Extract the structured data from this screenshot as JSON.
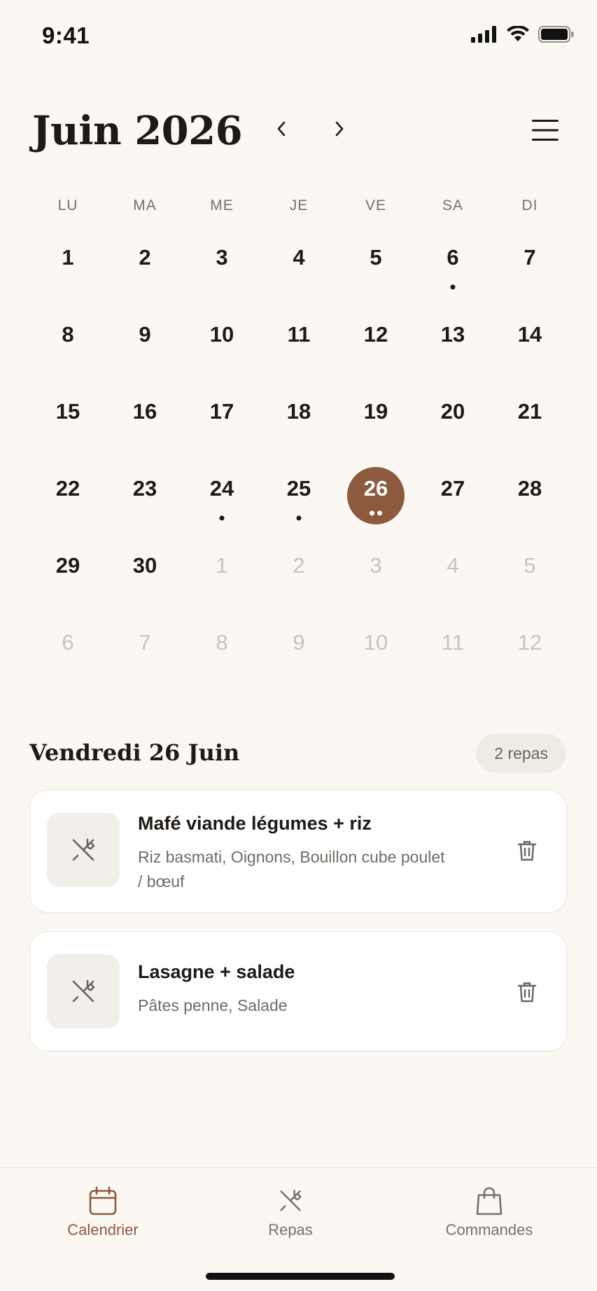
{
  "status": {
    "time": "9:41"
  },
  "header": {
    "month_title": "Juin 2026"
  },
  "weekdays": [
    "LU",
    "MA",
    "ME",
    "JE",
    "VE",
    "SA",
    "DI"
  ],
  "calendar": {
    "days": [
      {
        "n": "1",
        "muted": false,
        "dots": 0
      },
      {
        "n": "2",
        "muted": false,
        "dots": 0
      },
      {
        "n": "3",
        "muted": false,
        "dots": 0
      },
      {
        "n": "4",
        "muted": false,
        "dots": 0
      },
      {
        "n": "5",
        "muted": false,
        "dots": 0
      },
      {
        "n": "6",
        "muted": false,
        "dots": 1
      },
      {
        "n": "7",
        "muted": false,
        "dots": 0
      },
      {
        "n": "8",
        "muted": false,
        "dots": 0
      },
      {
        "n": "9",
        "muted": false,
        "dots": 0
      },
      {
        "n": "10",
        "muted": false,
        "dots": 0
      },
      {
        "n": "11",
        "muted": false,
        "dots": 0
      },
      {
        "n": "12",
        "muted": false,
        "dots": 0
      },
      {
        "n": "13",
        "muted": false,
        "dots": 0
      },
      {
        "n": "14",
        "muted": false,
        "dots": 0
      },
      {
        "n": "15",
        "muted": false,
        "dots": 0
      },
      {
        "n": "16",
        "muted": false,
        "dots": 0
      },
      {
        "n": "17",
        "muted": false,
        "dots": 0
      },
      {
        "n": "18",
        "muted": false,
        "dots": 0
      },
      {
        "n": "19",
        "muted": false,
        "dots": 0
      },
      {
        "n": "20",
        "muted": false,
        "dots": 0
      },
      {
        "n": "21",
        "muted": false,
        "dots": 0
      },
      {
        "n": "22",
        "muted": false,
        "dots": 0
      },
      {
        "n": "23",
        "muted": false,
        "dots": 0
      },
      {
        "n": "24",
        "muted": false,
        "dots": 1
      },
      {
        "n": "25",
        "muted": false,
        "dots": 1
      },
      {
        "n": "26",
        "muted": false,
        "dots": 2,
        "selected": true
      },
      {
        "n": "27",
        "muted": false,
        "dots": 0
      },
      {
        "n": "28",
        "muted": false,
        "dots": 0
      },
      {
        "n": "29",
        "muted": false,
        "dots": 0
      },
      {
        "n": "30",
        "muted": false,
        "dots": 0
      },
      {
        "n": "1",
        "muted": true,
        "dots": 0
      },
      {
        "n": "2",
        "muted": true,
        "dots": 0
      },
      {
        "n": "3",
        "muted": true,
        "dots": 0
      },
      {
        "n": "4",
        "muted": true,
        "dots": 0
      },
      {
        "n": "5",
        "muted": true,
        "dots": 0
      },
      {
        "n": "6",
        "muted": true,
        "dots": 0
      },
      {
        "n": "7",
        "muted": true,
        "dots": 0
      },
      {
        "n": "8",
        "muted": true,
        "dots": 0
      },
      {
        "n": "9",
        "muted": true,
        "dots": 0
      },
      {
        "n": "10",
        "muted": true,
        "dots": 0
      },
      {
        "n": "11",
        "muted": true,
        "dots": 0
      },
      {
        "n": "12",
        "muted": true,
        "dots": 0
      }
    ]
  },
  "selected_day": {
    "title": "Vendredi 26 Juin",
    "count": "2 repas",
    "meals": [
      {
        "name": "Mafé viande légumes + riz",
        "ingredients": "Riz basmati, Oignons, Bouillon cube poulet / bœuf"
      },
      {
        "name": "Lasagne + salade",
        "ingredients": "Pâtes penne, Salade"
      }
    ]
  },
  "tabs": {
    "calendar": "Calendrier",
    "meals": "Repas",
    "orders": "Commandes"
  },
  "colors": {
    "accent": "#8c5a3c",
    "background": "#fbf8f4",
    "muted_text": "#c9c3bd"
  },
  "icons": {
    "prev": "chevron-left-icon",
    "next": "chevron-right-icon",
    "menu": "hamburger-menu-icon",
    "meal": "fork-knife-icon",
    "delete": "trash-icon",
    "tab_calendar": "calendar-icon",
    "tab_meals": "fork-knife-icon",
    "tab_orders": "shopping-bag-icon"
  }
}
